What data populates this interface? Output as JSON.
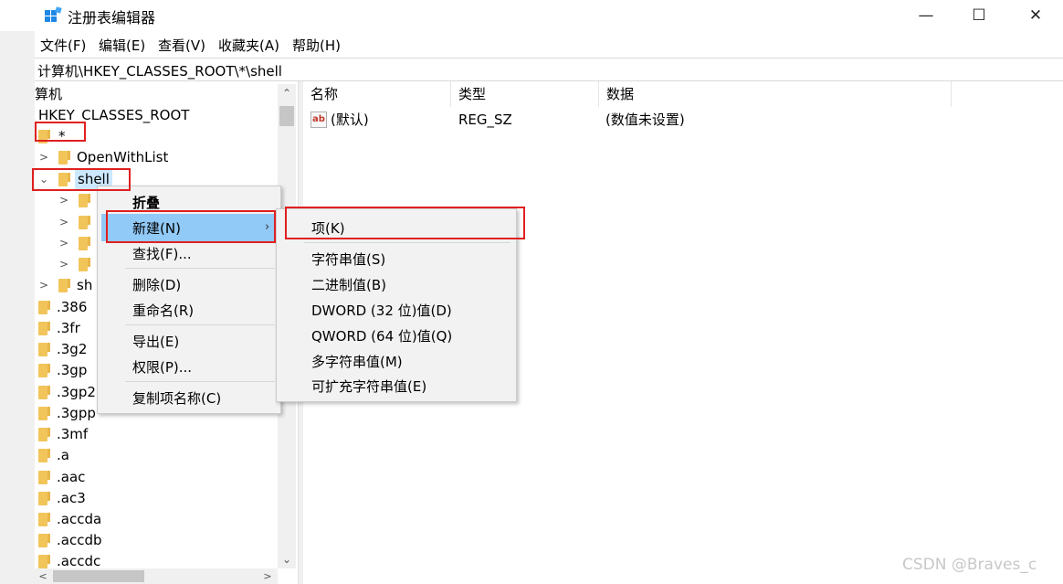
{
  "window": {
    "title": "注册表编辑器",
    "min_glyph": "—",
    "max_glyph": "☐",
    "close_glyph": "✕"
  },
  "menubar": {
    "items": [
      "文件(F)",
      "编辑(E)",
      "查看(V)",
      "收藏夹(A)",
      "帮助(H)"
    ]
  },
  "address": {
    "path": "计算机\\HKEY_CLASSES_ROOT\\*\\shell"
  },
  "tree": {
    "root": "算机",
    "hive": "HKEY_CLASSES_ROOT",
    "star": "*",
    "openwithlist": "OpenWithList",
    "shell": "shell",
    "shellex_partial": "sh",
    "extensions": [
      ".386",
      ".3fr",
      ".3g2",
      ".3gp",
      ".3gp2",
      ".3gpp",
      ".3mf",
      ".a",
      ".aac",
      ".ac3",
      ".accda",
      ".accdb",
      ".accdc"
    ]
  },
  "list": {
    "headers": {
      "name": "名称",
      "type": "类型",
      "data": "数据"
    },
    "rows": [
      {
        "name": "(默认)",
        "type": "REG_SZ",
        "data": "(数值未设置)"
      }
    ],
    "icon_glyph": "ab"
  },
  "context_menu": {
    "collapse": "折叠",
    "new": "新建(N)",
    "find": "查找(F)...",
    "delete": "删除(D)",
    "rename": "重命名(R)",
    "export": "导出(E)",
    "permissions": "权限(P)...",
    "copy_name": "复制项名称(C)",
    "submenu_arrow": "›"
  },
  "submenu": {
    "key": "项(K)",
    "string": "字符串值(S)",
    "binary": "二进制值(B)",
    "dword": "DWORD (32 位)值(D)",
    "qword": "QWORD (64 位)值(Q)",
    "multistring": "多字符串值(M)",
    "expandstring": "可扩充字符串值(E)"
  },
  "watermark": "CSDN @Braves_c",
  "colors": {
    "highlight": "#91c9f7",
    "annotation": "#e02020",
    "folder": "#f2c55b"
  }
}
